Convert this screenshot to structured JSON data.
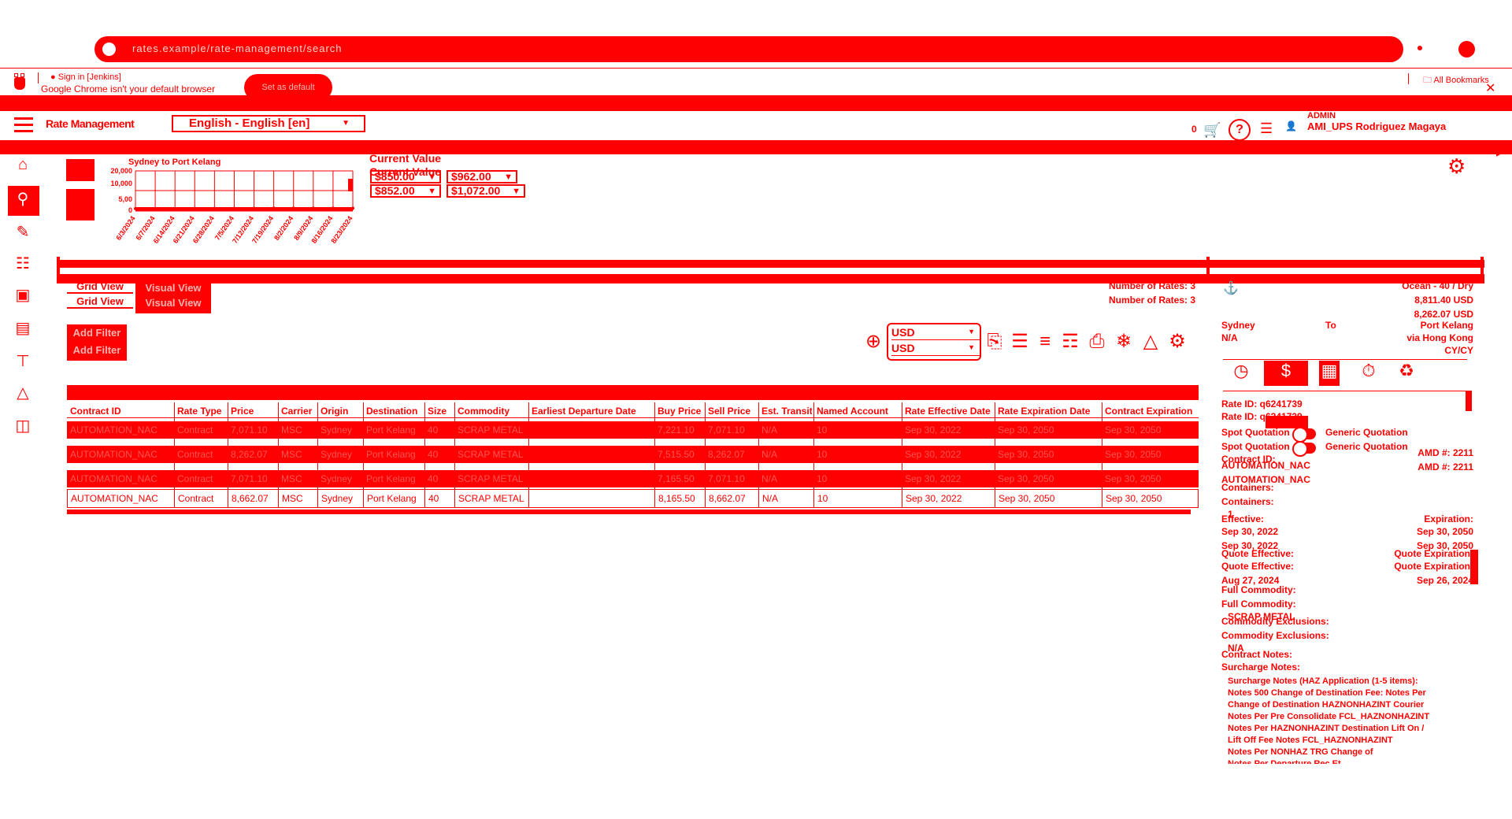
{
  "browser": {
    "url": "rates.example/rate-management/search",
    "bookmarks": {
      "jenkins": "Sign in [Jenkins]",
      "all": "All Bookmarks"
    },
    "infobar": {
      "message": "Google Chrome isn't your default browser",
      "button": "Set as default",
      "close": "✕"
    }
  },
  "header": {
    "title_top": "Rate Management",
    "title_bottom": "Rate Management",
    "language": "English - English [en]",
    "cart_count": "0",
    "help": "?",
    "user_role": "ADMIN",
    "user_name": "AMI_UPS Rodriguez Magaya"
  },
  "chart": {
    "title": "Sydney to Port Kelang",
    "current_value_label": "Current Value",
    "current_values": [
      "$850.00",
      "$962.00",
      "$852.00",
      "$1,072.00"
    ]
  },
  "chart_data": {
    "type": "line",
    "title": "Sydney to Port Kelang",
    "xlabel": "",
    "ylabel": "",
    "y_tick_labels": [
      "20,000",
      "10,000",
      "5,00",
      "0"
    ],
    "x": [
      "6/3/2024",
      "6/7/2024",
      "6/14/2024",
      "6/21/2024",
      "6/28/2024",
      "7/5/2024",
      "7/12/2024",
      "7/19/2024",
      "8/2/2024",
      "8/9/2024",
      "8/16/2024",
      "8/23/2024"
    ],
    "series": [
      {
        "values": [
          850,
          850,
          852,
          900,
          962,
          962,
          1000,
          1072,
          1072,
          1072,
          1072,
          1072
        ]
      }
    ],
    "ylim": [
      0,
      20000
    ],
    "grid": true
  },
  "view": {
    "grid_label": "Grid View",
    "visual_label": "Visual View",
    "num_rates": "Number of Rates: 3",
    "add_filter": "Add Filter",
    "currency": "USD"
  },
  "table": {
    "headers": [
      "Contract ID",
      "Rate Type",
      "Price",
      "Carrier",
      "Origin",
      "Destination",
      "Size",
      "Commodity",
      "Earliest Departure Date",
      "Buy Price",
      "Sell Price",
      "Est. Transit",
      "Named Account",
      "Rate Effective Date",
      "Rate Expiration Date",
      "Contract Expiration"
    ],
    "rows": [
      [
        "AUTOMATION_NAC",
        "Contract",
        "7,071.10",
        "MSC",
        "Sydney",
        "Port Kelang",
        "40",
        "SCRAP METAL",
        "",
        "7,221.10",
        "7,071.10",
        "N/A",
        "10",
        "Sep 30, 2022",
        "Sep 30, 2050",
        "Sep 30, 2050"
      ],
      [
        "AUTOMATION_NAC",
        "Contract",
        "8,262.07",
        "MSC",
        "Sydney",
        "Port Kelang",
        "40",
        "SCRAP METAL",
        "",
        "7,515.50",
        "8,262.07",
        "N/A",
        "10",
        "Sep 30, 2022",
        "Sep 30, 2050",
        "Sep 30, 2050"
      ],
      [
        "AUTOMATION_NAC",
        "Contract",
        "7,071.10",
        "MSC",
        "Sydney",
        "Port Kelang",
        "40",
        "SCRAP METAL",
        "",
        "7,165.50",
        "7,071.10",
        "N/A",
        "10",
        "Sep 30, 2022",
        "Sep 30, 2050",
        "Sep 30, 2050"
      ],
      [
        "AUTOMATION_NAC",
        "Contract",
        "8,662.07",
        "MSC",
        "Sydney",
        "Port Kelang",
        "40",
        "SCRAP METAL",
        "",
        "8,165.50",
        "8,662.07",
        "N/A",
        "10",
        "Sep 30, 2022",
        "Sep 30, 2050",
        "Sep 30, 2050"
      ]
    ]
  },
  "panel": {
    "mode": "Ocean - 40 / Dry",
    "price_a": "8,811.40 USD",
    "price_b": "8,262.07 USD",
    "origin": "Sydney",
    "to": "To",
    "destination": "Port Kelang",
    "origin_sub": "N/A",
    "via": "via Hong Kong",
    "dest_sub": "CY/CY",
    "rate_id": "Rate ID: q6241739",
    "rate_id2": "Rate ID: q6241739",
    "spot_quotation": "Spot Quotation",
    "generic_quotation": "Generic Quotation",
    "contract_id_lbl": "Contract ID:",
    "contract_id": "AUTOMATION_NAC",
    "amd": "AMD #: 2211",
    "containers_lbl": "Containers:",
    "containers": "1",
    "effective_lbl": "Effective:",
    "effective": "Sep 30, 2022",
    "expiration_lbl": "Expiration:",
    "expiration": "Sep 30, 2050",
    "quote_eff_lbl": "Quote Effective:",
    "quote_eff": "Aug 27, 2024",
    "quote_exp_lbl": "Quote Expiration:",
    "quote_exp": "Sep 26, 2024",
    "full_commodity_lbl": "Full Commodity:",
    "full_commodity": "SCRAP METAL",
    "exclusions_lbl": "Commodity Exclusions:",
    "exclusions": "N/A",
    "contract_notes_lbl": "Contract Notes:",
    "surcharge_lbl": "Surcharge Notes:",
    "notes": [
      "Surcharge Notes (HAZ Application (1-5 items):",
      "Notes 500 Change of Destination Fee: Notes Per",
      "Change of Destination HAZNONHAZINT Courier",
      "Notes Per Pre Consolidate FCL_HAZNONHAZINT",
      "Notes Per HAZNONHAZINT Destination Lift On /",
      "Lift Off Fee Notes FCL_HAZNONHAZINT",
      "Notes Per NONHAZ TRG Change of",
      "Notes Per Departure Rec Et"
    ]
  }
}
